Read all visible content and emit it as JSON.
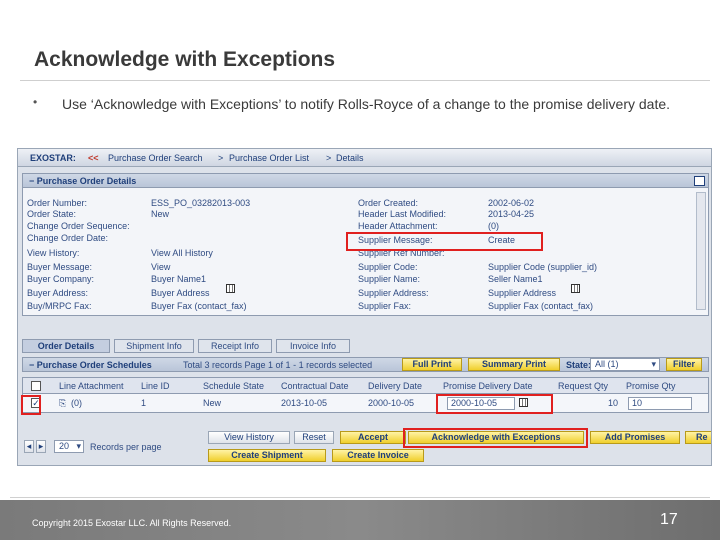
{
  "slide": {
    "title": "Acknowledge with Exceptions",
    "bullet": "•",
    "bullet_text": "Use ‘Acknowledge with Exceptions’ to notify Rolls-Royce of a change to the promise delivery date.",
    "copyright": "Copyright 2015 Exostar LLC. All Rights Reserved.",
    "page_number": "17"
  },
  "app": {
    "logo": "EXOSTAR:",
    "breadcrumb": {
      "back": "<<",
      "items": [
        "Purchase Order Search",
        ">",
        "Purchase Order List",
        ">",
        "Details"
      ]
    },
    "po_details": {
      "header": "− Purchase Order Details",
      "left_fields": [
        {
          "label": "Order Number:",
          "value": "ESS_PO_03282013-003"
        },
        {
          "label": "Order State:",
          "value": "New"
        },
        {
          "label": "Change Order Sequence:",
          "value": ""
        },
        {
          "label": "Change Order Date:",
          "value": ""
        },
        {
          "label": "View History:",
          "value": "View All History"
        },
        {
          "label": "Buyer Message:",
          "value": "View"
        },
        {
          "label": "Buyer Company:",
          "value": "Buyer Name1"
        },
        {
          "label": "Buyer Address:",
          "value": "Buyer Address"
        },
        {
          "label": "Buy/MRPC Fax:",
          "value": "Buyer Fax (contact_fax)"
        }
      ],
      "right_fields": [
        {
          "label": "Order Created:",
          "value": "2002-06-02"
        },
        {
          "label": "Header Last Modified:",
          "value": "2013-04-25"
        },
        {
          "label": "Header Attachment:",
          "value": "(0)"
        },
        {
          "label": "Supplier Message:",
          "value": "Create"
        },
        {
          "label": "Supplier Ref Number:",
          "value": ""
        },
        {
          "label": "Supplier Code:",
          "value": "Supplier Code (supplier_id)"
        },
        {
          "label": "Supplier Name:",
          "value": "Seller Name1"
        },
        {
          "label": "Supplier Address:",
          "value": "Supplier Address"
        },
        {
          "label": "Supplier Fax:",
          "value": "Supplier Fax (contact_fax)"
        }
      ]
    },
    "tabs": [
      "Order Details",
      "Shipment Info",
      "Receipt Info",
      "Invoice Info"
    ],
    "schedules": {
      "title": "− Purchase Order Schedules",
      "records_info": "Total 3 records Page 1 of 1 - 1 records selected",
      "full_print": "Full Print",
      "summary_print": "Summary Print",
      "state_label": "State:",
      "state_value": "All (1)",
      "filter": "Filter",
      "columns": [
        "Line Attachment",
        "Line ID",
        "Schedule State",
        "Contractual Date",
        "Delivery Date",
        "Promise Delivery Date",
        "Request Qty",
        "Promise Qty"
      ],
      "row": {
        "checked": "✓",
        "attachment": "(0)",
        "line_id": "1",
        "state": "New",
        "contractual_date": "2013-10-05",
        "delivery_date": "2000-10-05",
        "promise_date": "2000-10-05",
        "request_qty": "10",
        "promise_qty": "10"
      }
    },
    "bottom": {
      "page_size": "20",
      "records_per_page": "Records per page",
      "view_history": "View History",
      "reset": "Reset",
      "accept": "Accept",
      "ack_exceptions": "Acknowledge with Exceptions",
      "add_promises": "Add Promises",
      "reject": "Re",
      "create_shipment": "Create Shipment",
      "create_invoice": "Create Invoice"
    }
  },
  "colors": {
    "highlight": "#e0201f",
    "button_yellow": "#f0cf2b",
    "link_blue": "#2f4b82",
    "footer_gray": "#7a7a7a"
  }
}
